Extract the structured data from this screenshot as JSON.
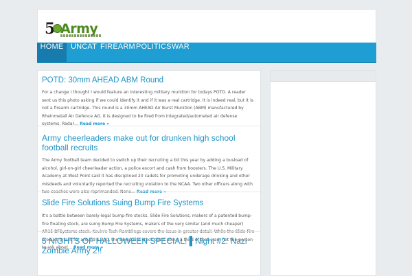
{
  "site": {
    "logo_number": "5",
    "logo_word": "Army",
    "logo_tagline": "GET YOUR NEWS DONE QUICKLY BY 5 ARMY"
  },
  "nav": {
    "items": [
      {
        "label": "HOME",
        "active": true
      },
      {
        "label": "UNCAT",
        "active": false
      },
      {
        "label": "FIREARM",
        "active": false
      },
      {
        "label": "POLITICS",
        "active": false
      },
      {
        "label": "WAR",
        "active": false
      }
    ]
  },
  "posts": [
    {
      "title": "POTD: 30mm AHEAD ABM Round",
      "excerpt": "For a change I thought I would feature an interesting military munition for todays POTD. A reader sent us this photo asking if we could identify it and if it was a real cartridge. It is indeed real, but it is not a firearm cartridge. This round is a 30mm AHEAD Air Burst Munition (ABM) manufactured by Rheinmetall Air Defence AG. It is designed to be fired from integrated/automated air defense systems. Radar…",
      "more": "Read more »"
    },
    {
      "title": "Army cheerleaders make out for drunken high school football recruits",
      "excerpt": "The Army football team decided to switch up their recruiting a bit this year by adding a busload of alcohol, girl-on-girl cheerleader action, a police escort and cash from boosters. The U.S. Military Academy at West Point said it has disciplined 20 cadets for promoting underage drinking and other misdeeds and voluntarily reported the recruiting violation to the NCAA. Two other officers along with two coaches were also reprimanded. None…",
      "more": "Read more »"
    },
    {
      "title": "Slide Fire Solutions Suing Bump Fire Systems",
      "excerpt": "It's a battle between barely-legal bump-fire stocks. Slide Fire Solutions, makers of a patented bump-fire floating stock, are suing Bump Fire Systems, makers of the very similar (and much cheaper) AR15 BFSystems stock. Kevin's Tech Ramblings covers the issue in greater detail. While the Slide Fire product retails for around $ 300, the Bump Fire stock costs about a third of that. I am not the person to ask about…",
      "more": "Read more »"
    },
    {
      "title": "5 NIGHTS OF HALLOWEEN SPECIAL! ▌Night #2: Nazi Zombie Army 2!!",
      "excerpt": "",
      "more": ""
    }
  ]
}
